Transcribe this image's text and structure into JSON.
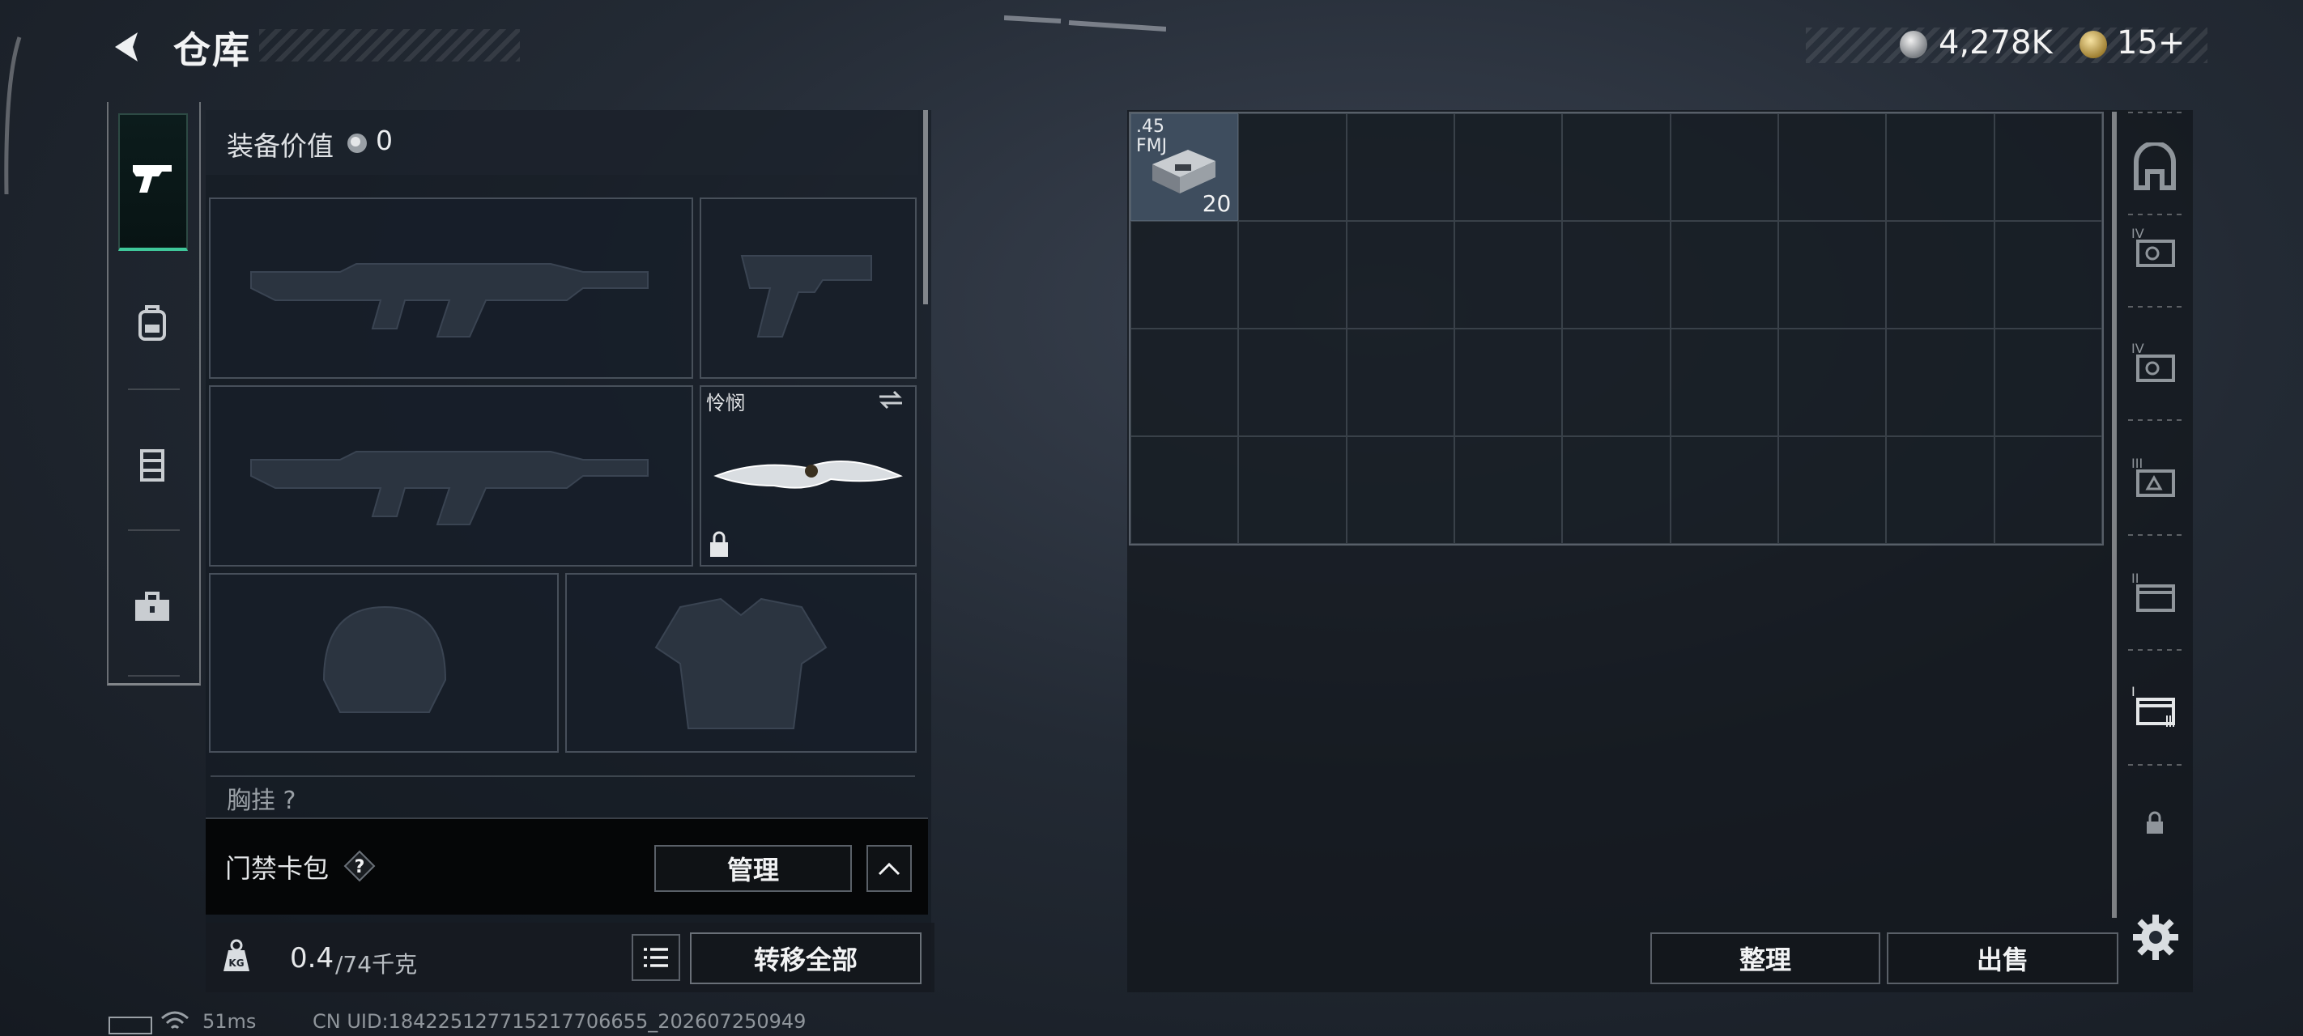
{
  "header": {
    "title": "仓库",
    "currency": [
      {
        "icon": "silver-coin-icon",
        "value": "4,278K"
      },
      {
        "icon": "gold-triangle-coin-icon",
        "value": "15+"
      }
    ]
  },
  "category_tabs": [
    {
      "icon": "pistol-icon",
      "active": true
    },
    {
      "icon": "backpack-icon",
      "active": false
    },
    {
      "icon": "vest-icon",
      "active": false
    },
    {
      "icon": "toolbox-icon",
      "active": false
    }
  ],
  "equipment": {
    "value_label": "装备价值",
    "value": "0",
    "slots": [
      {
        "name": "primary-weapon-1",
        "icon": "assault-rifle-icon"
      },
      {
        "name": "sidearm",
        "icon": "pistol-icon"
      },
      {
        "name": "primary-weapon-2",
        "icon": "assault-rifle-icon"
      },
      {
        "name": "melee",
        "label": "怜悯",
        "icon": "karambit-knife-icon"
      },
      {
        "name": "helmet",
        "icon": "helmet-icon"
      },
      {
        "name": "armor",
        "icon": "body-armor-icon"
      }
    ],
    "chest_rig_label": "胸挂",
    "chest_rig_value": "?"
  },
  "card_pack": {
    "label": "门禁卡包",
    "help": "?",
    "manage_label": "管理"
  },
  "weight": {
    "current": "0.4",
    "capacity": "/74千克",
    "transfer_all_label": "转移全部"
  },
  "storage": {
    "items": [
      {
        "caliber": ".45\nFMJ",
        "count": "20"
      }
    ],
    "sort_label": "整理",
    "sell_label": "出售",
    "containers": [
      {
        "icon": "safe-box-icon"
      },
      {
        "icon": "container-iv-icon",
        "label": "IV"
      },
      {
        "icon": "container-iv-icon",
        "label": "IV"
      },
      {
        "icon": "container-iii-icon",
        "label": "III"
      },
      {
        "icon": "container-ii-icon",
        "label": "II"
      },
      {
        "icon": "container-i-icon",
        "label": "I"
      },
      {
        "icon": "lock-icon"
      }
    ]
  },
  "status": {
    "ping": "51ms",
    "uid": "CN UID:18422512771521770665​5_202607250949"
  },
  "colors": {
    "accent": "#3fc79a",
    "background": "#1d232c"
  }
}
